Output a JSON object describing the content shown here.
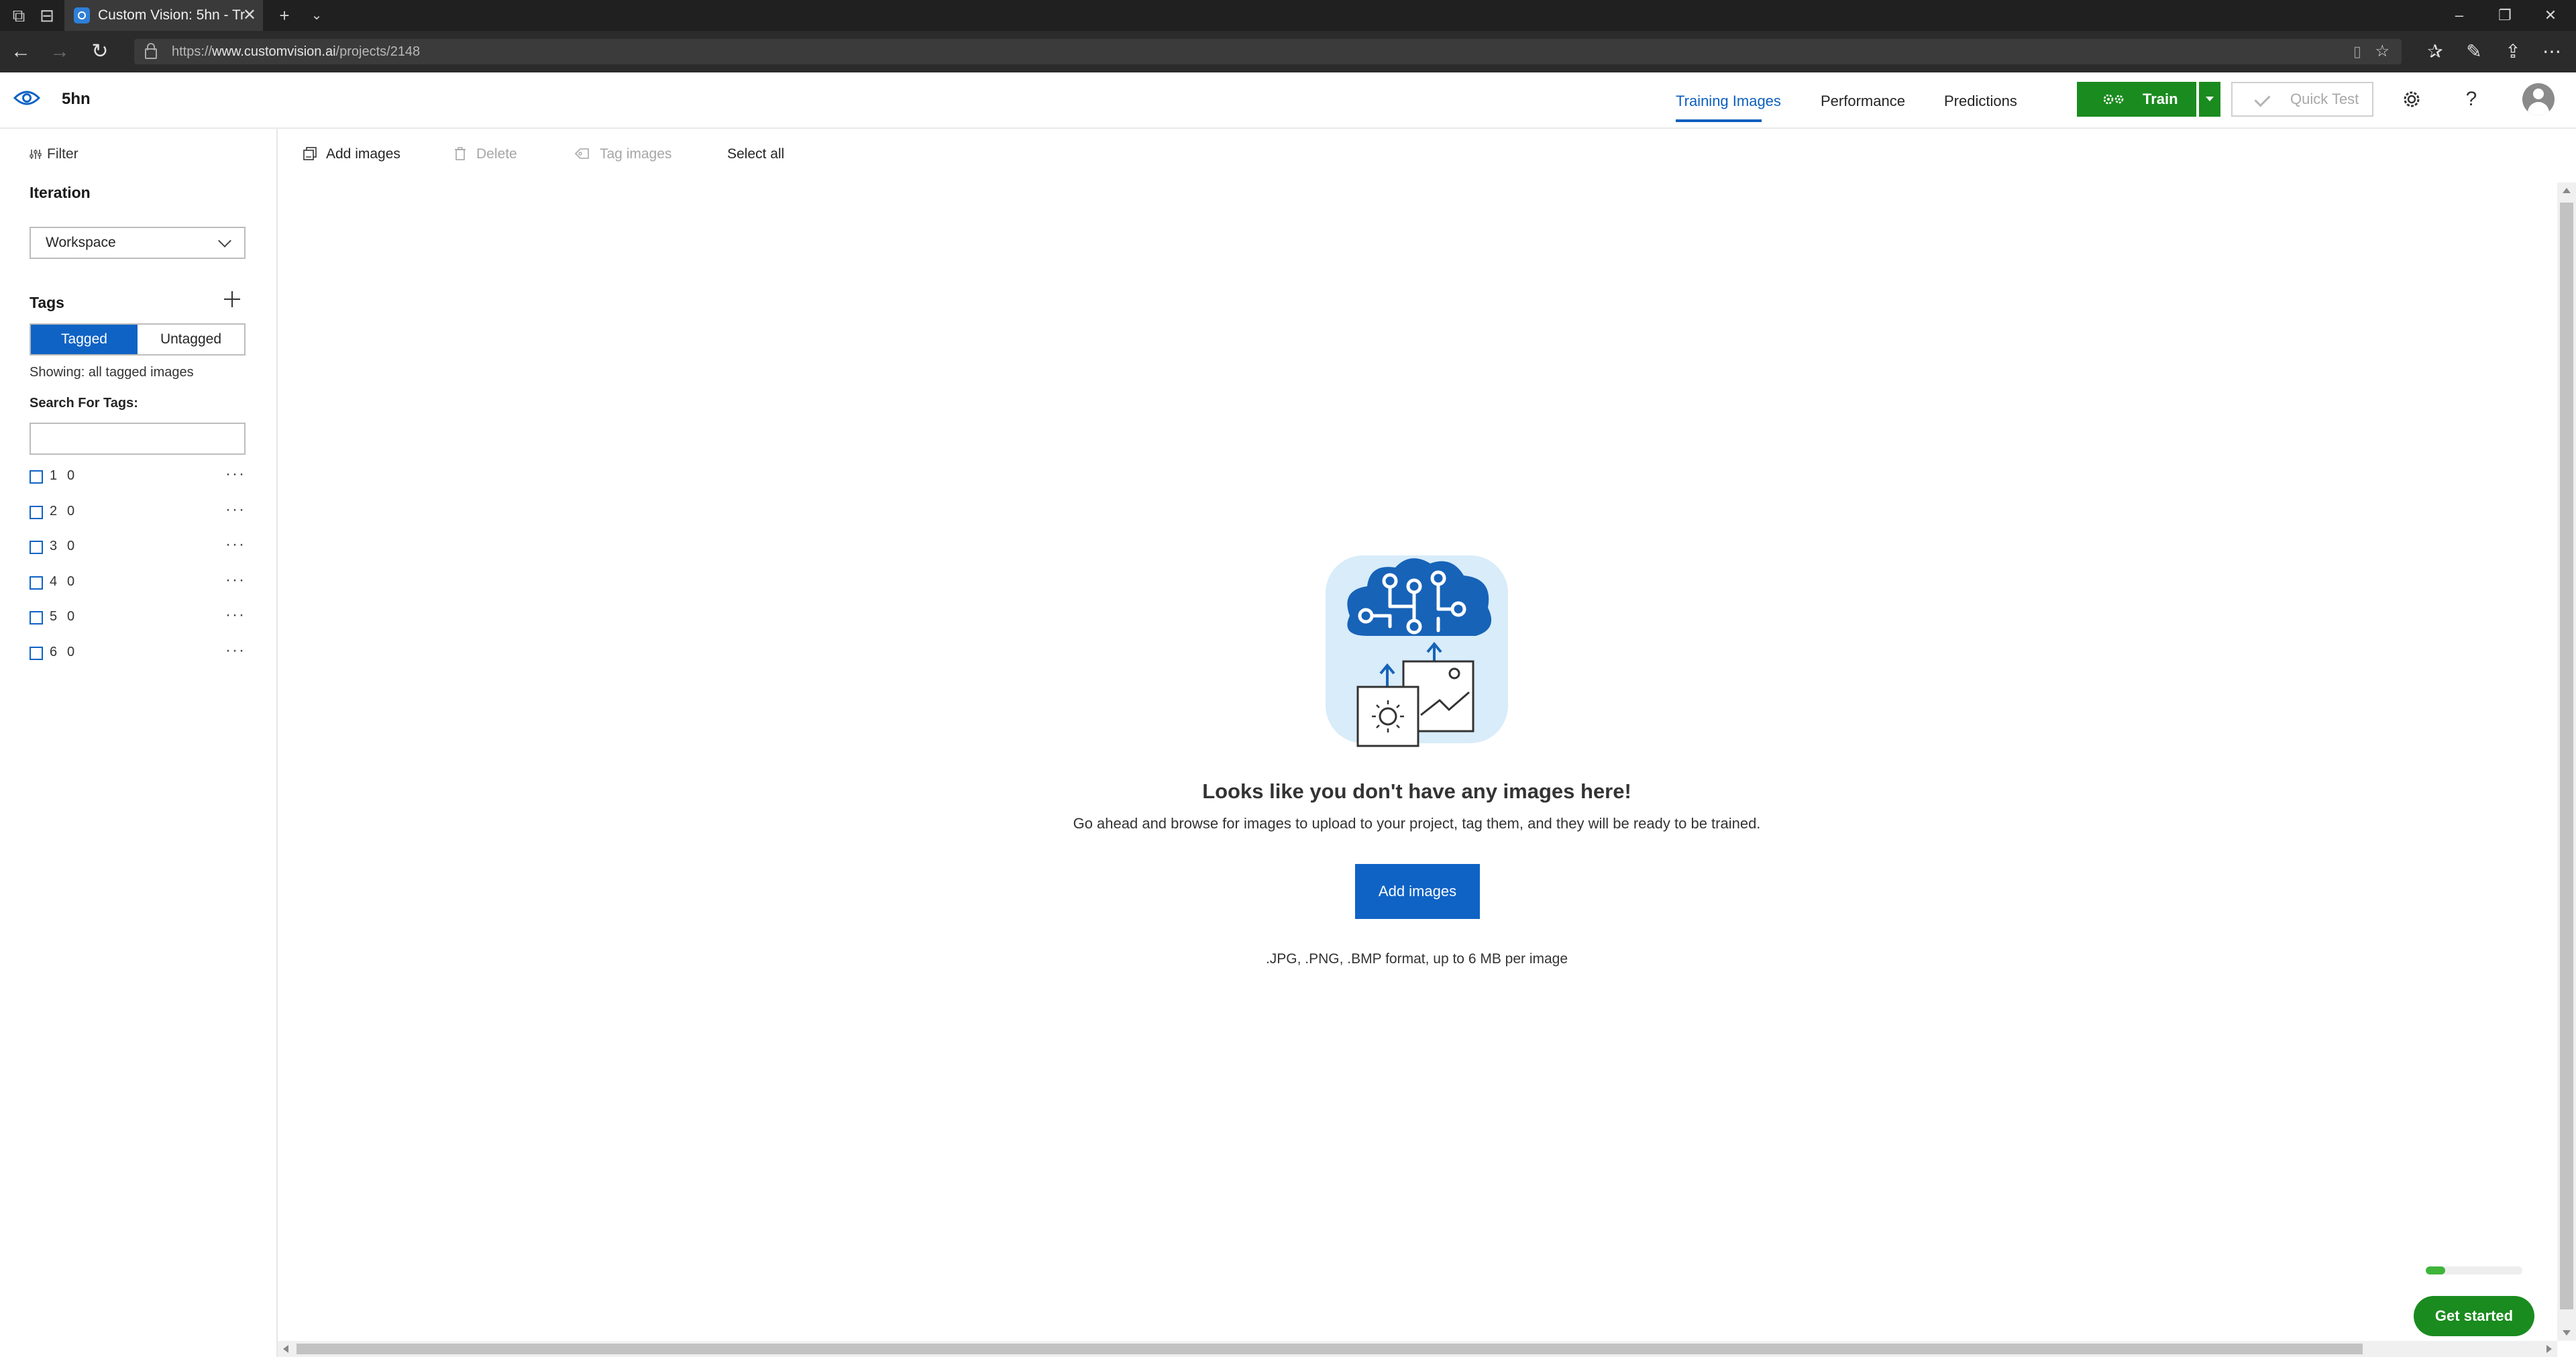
{
  "browser": {
    "tab_title": "Custom Vision: 5hn - Tr",
    "url_prefix": "https://",
    "url_host": "www.customvision.ai",
    "url_path": "/projects/2148"
  },
  "header": {
    "project_name": "5hn",
    "tabs": [
      {
        "label": "Training Images",
        "active": true
      },
      {
        "label": "Performance",
        "active": false
      },
      {
        "label": "Predictions",
        "active": false
      }
    ],
    "train_label": "Train",
    "quick_test_label": "Quick Test"
  },
  "sidebar": {
    "filter_label": "Filter",
    "iteration_label": "Iteration",
    "iteration_value": "Workspace",
    "tags_label": "Tags",
    "toggle": {
      "tagged": "Tagged",
      "untagged": "Untagged",
      "selected": "Tagged"
    },
    "showing_text": "Showing: all tagged images",
    "search_label": "Search For Tags:",
    "search_value": "",
    "tags": [
      {
        "name": "1",
        "count": "0"
      },
      {
        "name": "2",
        "count": "0"
      },
      {
        "name": "3",
        "count": "0"
      },
      {
        "name": "4",
        "count": "0"
      },
      {
        "name": "5",
        "count": "0"
      },
      {
        "name": "6",
        "count": "0"
      }
    ]
  },
  "toolbar": {
    "add_images": "Add images",
    "delete": "Delete",
    "tag_images": "Tag images",
    "select_all": "Select all"
  },
  "empty_state": {
    "title": "Looks like you don't have any images here!",
    "description": "Go ahead and browse for images to upload to your project, tag them, and they will be ready to be trained.",
    "button_label": "Add images",
    "formats": ".JPG, .PNG, .BMP format, up to 6 MB per image"
  },
  "footer": {
    "get_started_label": "Get started",
    "progress_fraction": 0.2
  },
  "icons": {
    "back": "arrow-left-icon",
    "forward": "arrow-right-icon",
    "refresh": "refresh-icon",
    "settings": "gear-icon",
    "help": "question-icon",
    "user": "avatar-icon",
    "brand": "eye-icon"
  },
  "colors": {
    "accent_blue": "#0f63c5",
    "train_green": "#1a8b1e",
    "progress_green": "#3fb43a"
  }
}
